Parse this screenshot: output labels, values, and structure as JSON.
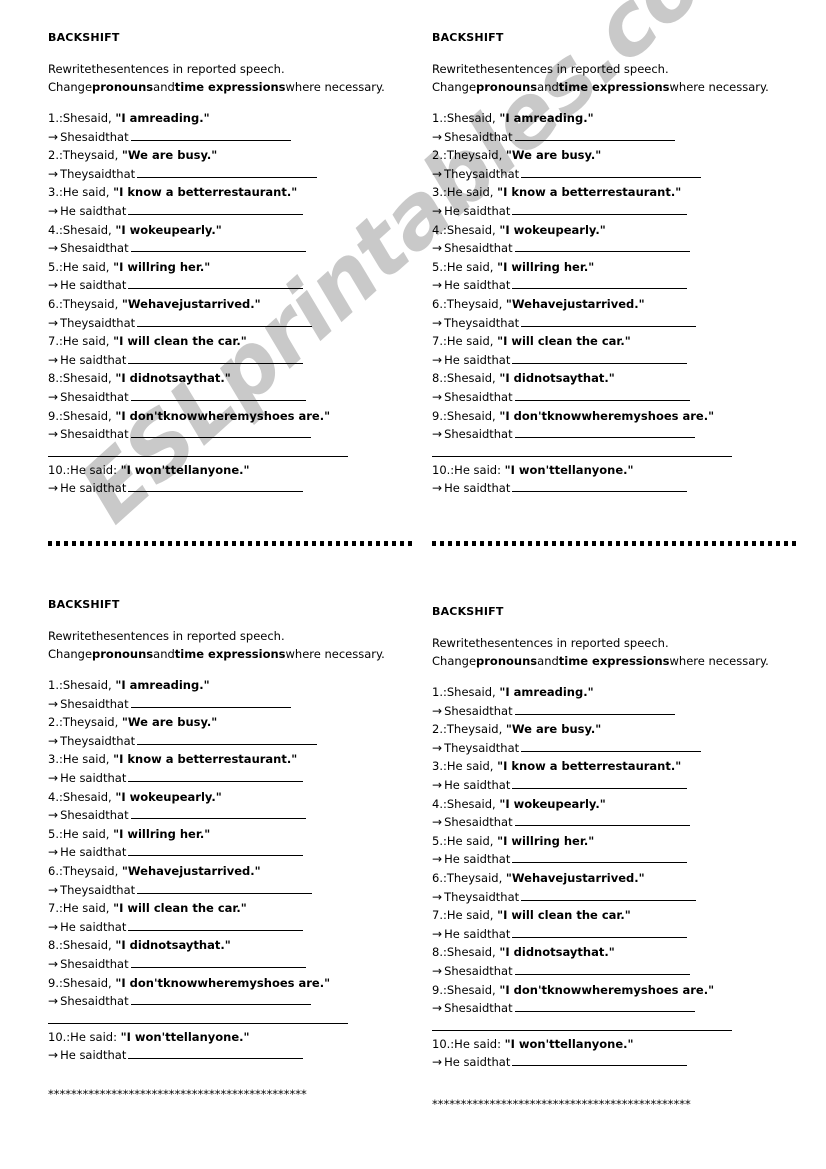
{
  "worksheet": {
    "title": "BACKSHIFT",
    "instructions": {
      "line1": "Rewritethesentences in reported speech.",
      "line2_a": "Change",
      "line2_b": "pronouns",
      "line2_c": "and",
      "line2_d": "time expressions",
      "line2_e": "where necessary."
    },
    "items": [
      {
        "number": "1.:",
        "speaker": "Shesaid,",
        "quote": "\"I amreading.\"",
        "answer_lead": "Shesaidthat",
        "arrow": "→"
      },
      {
        "number": "2.:",
        "speaker": "Theysaid,",
        "quote": "\"We are busy.\"",
        "answer_lead": "Theysaidthat",
        "arrow": "→"
      },
      {
        "number": "3.:",
        "speaker": "He said,",
        "quote": "\"I know a betterrestaurant.\"",
        "answer_lead": "He saidthat",
        "arrow": "→"
      },
      {
        "number": "4.:",
        "speaker": "Shesaid,",
        "quote": "\"I wokeupearly.\"",
        "answer_lead": "Shesaidthat",
        "arrow": "→"
      },
      {
        "number": "5.:",
        "speaker": "He said,",
        "quote": "\"I willring her.\"",
        "answer_lead": "He saidthat",
        "arrow": "→"
      },
      {
        "number": "6.:",
        "speaker": "Theysaid,",
        "quote": "\"Wehavejustarrived.\"",
        "answer_lead": "Theysaidthat",
        "arrow": "→"
      },
      {
        "number": "7.:",
        "speaker": "He said,",
        "quote": "\"I will clean the car.\"",
        "answer_lead": "He saidthat",
        "arrow": "→"
      },
      {
        "number": "8.:",
        "speaker": "Shesaid,",
        "quote": "\"I didnotsaythat.\"",
        "answer_lead": "Shesaidthat",
        "arrow": "→"
      },
      {
        "number": "9.:",
        "speaker": "Shesaid,",
        "quote": "\"I don'tknowwheremyshoes are.\"",
        "answer_lead": "Shesaidthat",
        "arrow": "→",
        "has_continuation_rule": true
      },
      {
        "number": "10.:",
        "speaker": "He said:",
        "quote": "\"I won'ttellanyone.\"",
        "answer_lead": "He saidthat",
        "arrow": "→"
      }
    ]
  },
  "separators": {
    "asterisk_row": "*********************************************"
  },
  "watermark": {
    "text": "ESLprintables.com",
    "color": "#c9c9c9"
  }
}
